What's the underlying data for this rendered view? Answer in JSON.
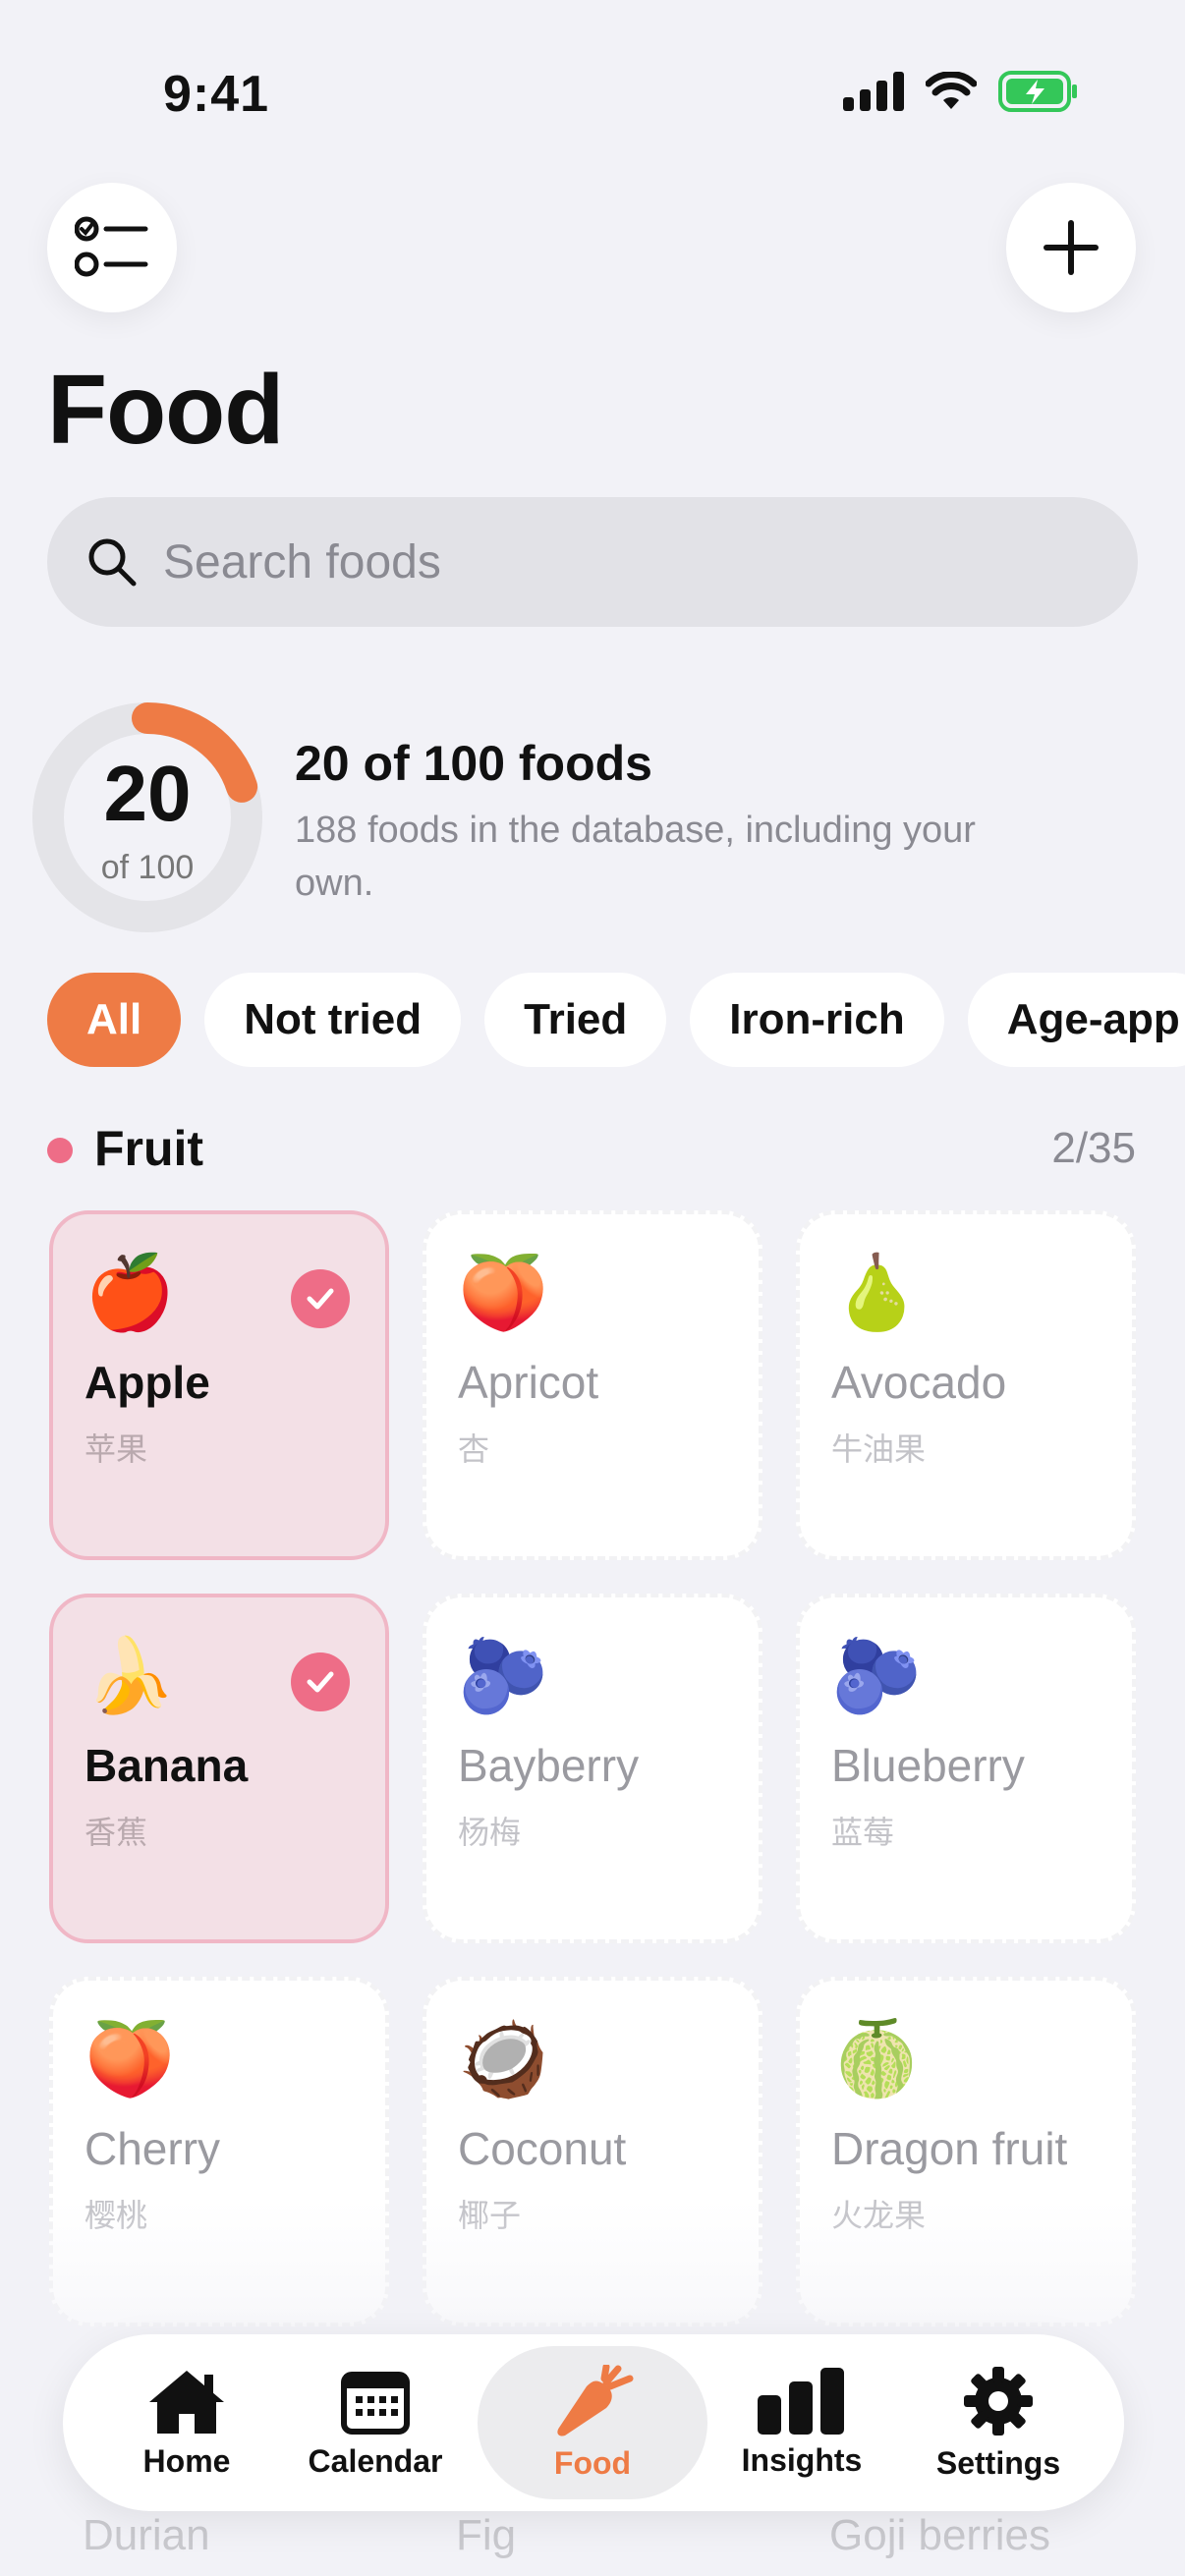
{
  "status_bar": {
    "time": "9:41"
  },
  "header": {
    "title": "Food"
  },
  "search": {
    "placeholder": "Search foods"
  },
  "progress": {
    "tried": "20",
    "of_label": "of 100",
    "fraction": 0.2,
    "title": "20 of 100 foods",
    "description": "188 foods in the database, including your own."
  },
  "filters": [
    "All",
    "Not tried",
    "Tried",
    "Iron-rich",
    "Age-app"
  ],
  "section": {
    "title": "Fruit",
    "count": "2/35"
  },
  "foods": [
    {
      "name": "Apple",
      "cn": "苹果",
      "emoji": "🍎",
      "tried": true
    },
    {
      "name": "Apricot",
      "cn": "杏",
      "emoji": "🍑",
      "tried": false
    },
    {
      "name": "Avocado",
      "cn": "牛油果",
      "emoji": "🍐",
      "tried": false
    },
    {
      "name": "Banana",
      "cn": "香蕉",
      "emoji": "🍌",
      "tried": true
    },
    {
      "name": "Bayberry",
      "cn": "杨梅",
      "emoji": "🫐",
      "tried": false
    },
    {
      "name": "Blueberry",
      "cn": "蓝莓",
      "emoji": "🫐",
      "tried": false
    },
    {
      "name": "Cherry",
      "cn": "樱桃",
      "emoji": "🍑",
      "tried": false
    },
    {
      "name": "Coconut",
      "cn": "椰子",
      "emoji": "🥥",
      "tried": false
    },
    {
      "name": "Dragon fruit",
      "cn": "火龙果",
      "emoji": "🍈",
      "tried": false
    }
  ],
  "faded_foods": [
    "Durian",
    "Fig",
    "Goji berries"
  ],
  "tabs": [
    {
      "label": "Home",
      "icon": "house-icon"
    },
    {
      "label": "Calendar",
      "icon": "calendar-icon"
    },
    {
      "label": "Food",
      "icon": "carrot-icon",
      "active": true
    },
    {
      "label": "Insights",
      "icon": "bar-chart-icon"
    },
    {
      "label": "Settings",
      "icon": "gear-icon"
    }
  ],
  "colors": {
    "accent": "#ee7b45",
    "tried_pink": "#ee6d87",
    "battery_green": "#34c759"
  }
}
